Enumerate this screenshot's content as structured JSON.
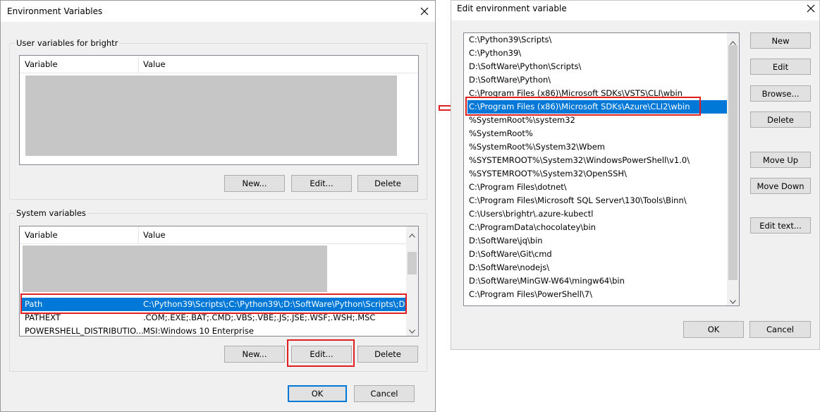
{
  "env_dialog": {
    "title": "Environment Variables",
    "user_group_label": "User variables for brightr",
    "user_columns": [
      "Variable",
      "Value"
    ],
    "user_buttons": {
      "new": "New...",
      "edit": "Edit...",
      "delete": "Delete"
    },
    "system_group_label": "System variables",
    "system_columns": [
      "Variable",
      "Value"
    ],
    "system_rows": [
      {
        "variable": "Path",
        "value": "C:\\Python39\\Scripts\\;C:\\Python39\\;D:\\SoftWare\\Python\\Scripts\\;D:...",
        "selected": true
      },
      {
        "variable": "PATHEXT",
        "value": ".COM;.EXE;.BAT;.CMD;.VBS;.VBE;.JS;.JSE;.WSF;.WSH;.MSC",
        "selected": false
      },
      {
        "variable": "POWERSHELL_DISTRIBUTIO...",
        "value": "MSI:Windows 10 Enterprise",
        "selected": false
      }
    ],
    "system_buttons": {
      "new": "New...",
      "edit": "Edit...",
      "delete": "Delete"
    },
    "ok": "OK",
    "cancel": "Cancel"
  },
  "edit_dialog": {
    "title": "Edit environment variable",
    "paths": [
      "C:\\Python39\\Scripts\\",
      "C:\\Python39\\",
      "D:\\SoftWare\\Python\\Scripts\\",
      "D:\\SoftWare\\Python\\",
      "C:\\Program Files (x86)\\Microsoft SDKs\\VSTS\\CLI\\wbin",
      "C:\\Program Files (x86)\\Microsoft SDKs\\Azure\\CLI2\\wbin",
      "%SystemRoot%\\system32",
      "%SystemRoot%",
      "%SystemRoot%\\System32\\Wbem",
      "%SYSTEMROOT%\\System32\\WindowsPowerShell\\v1.0\\",
      "%SYSTEMROOT%\\System32\\OpenSSH\\",
      "C:\\Program Files\\dotnet\\",
      "C:\\Program Files\\Microsoft SQL Server\\130\\Tools\\Binn\\",
      "C:\\Users\\brightr\\.azure-kubectl",
      "C:\\ProgramData\\chocolatey\\bin",
      "D:\\SoftWare\\jq\\bin",
      "D:\\SoftWare\\Git\\cmd",
      "D:\\SoftWare\\nodejs\\",
      "D:\\SoftWare\\MinGW-W64\\mingw64\\bin",
      "C:\\Program Files\\PowerShell\\7\\"
    ],
    "selected_index": 5,
    "buttons": {
      "new": "New",
      "edit": "Edit",
      "browse": "Browse...",
      "delete": "Delete",
      "move_up": "Move Up",
      "move_down": "Move Down",
      "edit_text": "Edit text..."
    },
    "ok": "OK",
    "cancel": "Cancel"
  },
  "icons": {
    "close": "close-icon",
    "arrow": "right-arrow-icon"
  },
  "colors": {
    "selection": "#0078d7",
    "highlight": "#e02020"
  }
}
